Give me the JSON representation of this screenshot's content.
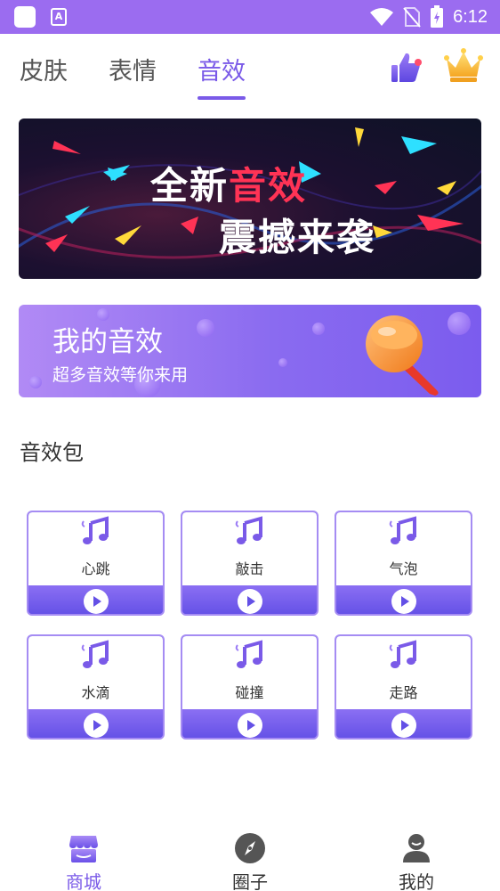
{
  "status_bar": {
    "time": "6:12",
    "app_icon_letter": "A",
    "background_color": "#9b6cf0"
  },
  "top_tabs": {
    "tabs": [
      {
        "label": "皮肤",
        "active": false
      },
      {
        "label": "表情",
        "active": false
      },
      {
        "label": "音效",
        "active": true
      }
    ],
    "accent_color": "#7a5ae8",
    "icons": [
      "thumbs-up-icon",
      "crown-icon"
    ]
  },
  "banner": {
    "line1_prefix": "全新",
    "line1_highlight": "音效",
    "line2": "震撼来袭"
  },
  "my_sound": {
    "title": "我的音效",
    "subtitle": "超多音效等你来用"
  },
  "section": {
    "title": "音效包"
  },
  "sound_packs": [
    {
      "label": "心跳"
    },
    {
      "label": "敲击"
    },
    {
      "label": "气泡"
    },
    {
      "label": "水滴"
    },
    {
      "label": "碰撞"
    },
    {
      "label": "走路"
    }
  ],
  "bottom_nav": {
    "items": [
      {
        "label": "商城",
        "icon": "store-icon",
        "active": true
      },
      {
        "label": "圈子",
        "icon": "compass-icon",
        "active": false
      },
      {
        "label": "我的",
        "icon": "user-icon",
        "active": false
      }
    ]
  }
}
